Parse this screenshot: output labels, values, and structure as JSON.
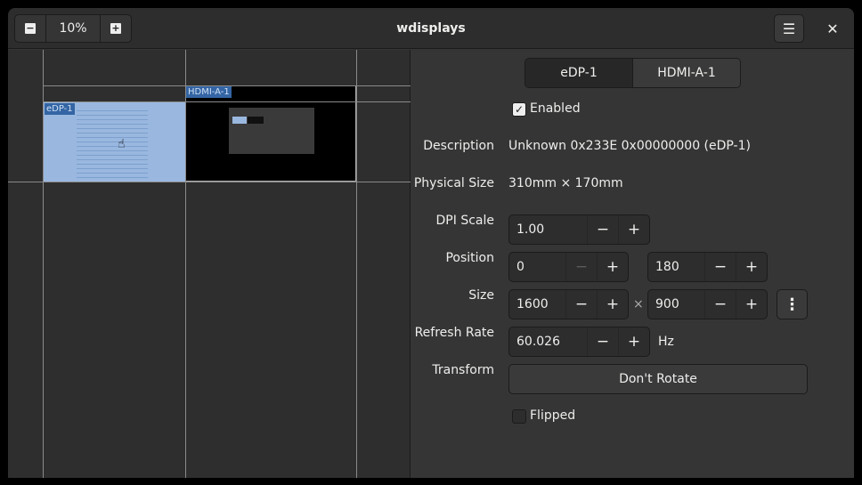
{
  "header": {
    "title": "wdisplays",
    "zoom": "10%",
    "zoom_out": "−",
    "zoom_in": "+",
    "menu_icon": "☰",
    "close_icon": "✕"
  },
  "canvas": {
    "monitors": [
      {
        "name": "eDP-1"
      },
      {
        "name": "HDMI-A-1"
      }
    ]
  },
  "tabs": [
    {
      "label": "eDP-1",
      "active": true
    },
    {
      "label": "HDMI-A-1",
      "active": false
    }
  ],
  "form": {
    "enabled": {
      "label": "Enabled",
      "checked": true
    },
    "description": {
      "label": "Description",
      "value": "Unknown 0x233E 0x00000000 (eDP-1)"
    },
    "physical_size": {
      "label": "Physical Size",
      "value": "310mm × 170mm"
    },
    "dpi_scale": {
      "label": "DPI Scale",
      "value": "1.00"
    },
    "position": {
      "label": "Position",
      "x": "0",
      "y": "180"
    },
    "size": {
      "label": "Size",
      "width": "1600",
      "height": "900",
      "separator": "×"
    },
    "refresh_rate": {
      "label": "Refresh Rate",
      "value": "60.026",
      "unit": "Hz"
    },
    "transform": {
      "label": "Transform",
      "value": "Don't Rotate"
    },
    "flipped": {
      "label": "Flipped",
      "checked": false
    },
    "minus": "−",
    "plus": "+",
    "more": "⋮"
  }
}
